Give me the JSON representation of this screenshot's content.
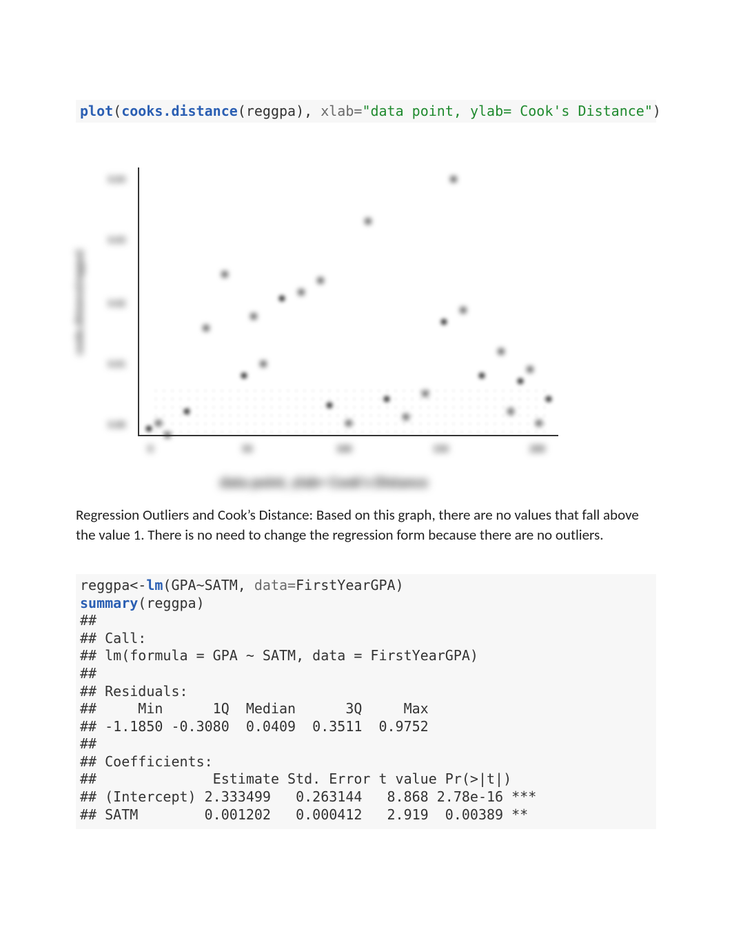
{
  "code1": {
    "fn_plot": "plot",
    "open1": "(",
    "fn_cooks": "cooks.distance",
    "open2": "(",
    "arg_var": "reggpa",
    "close2_comma": "), ",
    "named_xlab": "xlab=",
    "str_xlab": "\"data point, ylab= Cook's Distance\"",
    "close1": ")"
  },
  "chart_data": {
    "type": "scatter",
    "xlabel": "data point, ylab= Cook's Distance",
    "ylabel": "cooks.distance(reggpa)",
    "x_ticks": [
      "0",
      "50",
      "100",
      "150",
      "200"
    ],
    "y_ticks": [
      "0.00",
      "0.01",
      "0.02",
      "0.03",
      "0.04"
    ],
    "xlim": [
      0,
      220
    ],
    "ylim": [
      0,
      0.045
    ],
    "note": "values blurred in source; approximate",
    "points": [
      {
        "x": 5,
        "y": 0.001
      },
      {
        "x": 10,
        "y": 0.002
      },
      {
        "x": 15,
        "y": 0.0
      },
      {
        "x": 25,
        "y": 0.004
      },
      {
        "x": 35,
        "y": 0.018
      },
      {
        "x": 45,
        "y": 0.027
      },
      {
        "x": 55,
        "y": 0.01
      },
      {
        "x": 60,
        "y": 0.02
      },
      {
        "x": 65,
        "y": 0.012
      },
      {
        "x": 75,
        "y": 0.023
      },
      {
        "x": 85,
        "y": 0.024
      },
      {
        "x": 95,
        "y": 0.026
      },
      {
        "x": 100,
        "y": 0.005
      },
      {
        "x": 110,
        "y": 0.002
      },
      {
        "x": 120,
        "y": 0.036
      },
      {
        "x": 130,
        "y": 0.006
      },
      {
        "x": 140,
        "y": 0.003
      },
      {
        "x": 150,
        "y": 0.007
      },
      {
        "x": 160,
        "y": 0.019
      },
      {
        "x": 165,
        "y": 0.043
      },
      {
        "x": 170,
        "y": 0.021
      },
      {
        "x": 180,
        "y": 0.01
      },
      {
        "x": 190,
        "y": 0.014
      },
      {
        "x": 195,
        "y": 0.004
      },
      {
        "x": 200,
        "y": 0.009
      },
      {
        "x": 205,
        "y": 0.011
      },
      {
        "x": 210,
        "y": 0.002
      },
      {
        "x": 215,
        "y": 0.006
      }
    ]
  },
  "paragraph": "Regression Outliers and Cook’s Distance: Based on this graph, there are no values that fall above the value 1. There is no need to change the regression form because there are no outliers.",
  "code2": {
    "l1_pre": "reggpa<-",
    "l1_fn": "lm",
    "l1_open": "(GPA~SATM, ",
    "l1_named": "data=",
    "l1_post": "FirstYearGPA)",
    "l2_fn": "summary",
    "l2_args": "(reggpa)"
  },
  "output_lines": [
    "## ",
    "## Call:",
    "## lm(formula = GPA ~ SATM, data = FirstYearGPA)",
    "## ",
    "## Residuals:",
    "##     Min      1Q  Median      3Q     Max ",
    "## -1.1850 -0.3080  0.0409  0.3511  0.9752 ",
    "## ",
    "## Coefficients:",
    "##              Estimate Std. Error t value Pr(>|t|)    ",
    "## (Intercept) 2.333499   0.263144   8.868 2.78e-16 ***",
    "## SATM        0.001202   0.000412   2.919  0.00389 ** "
  ]
}
